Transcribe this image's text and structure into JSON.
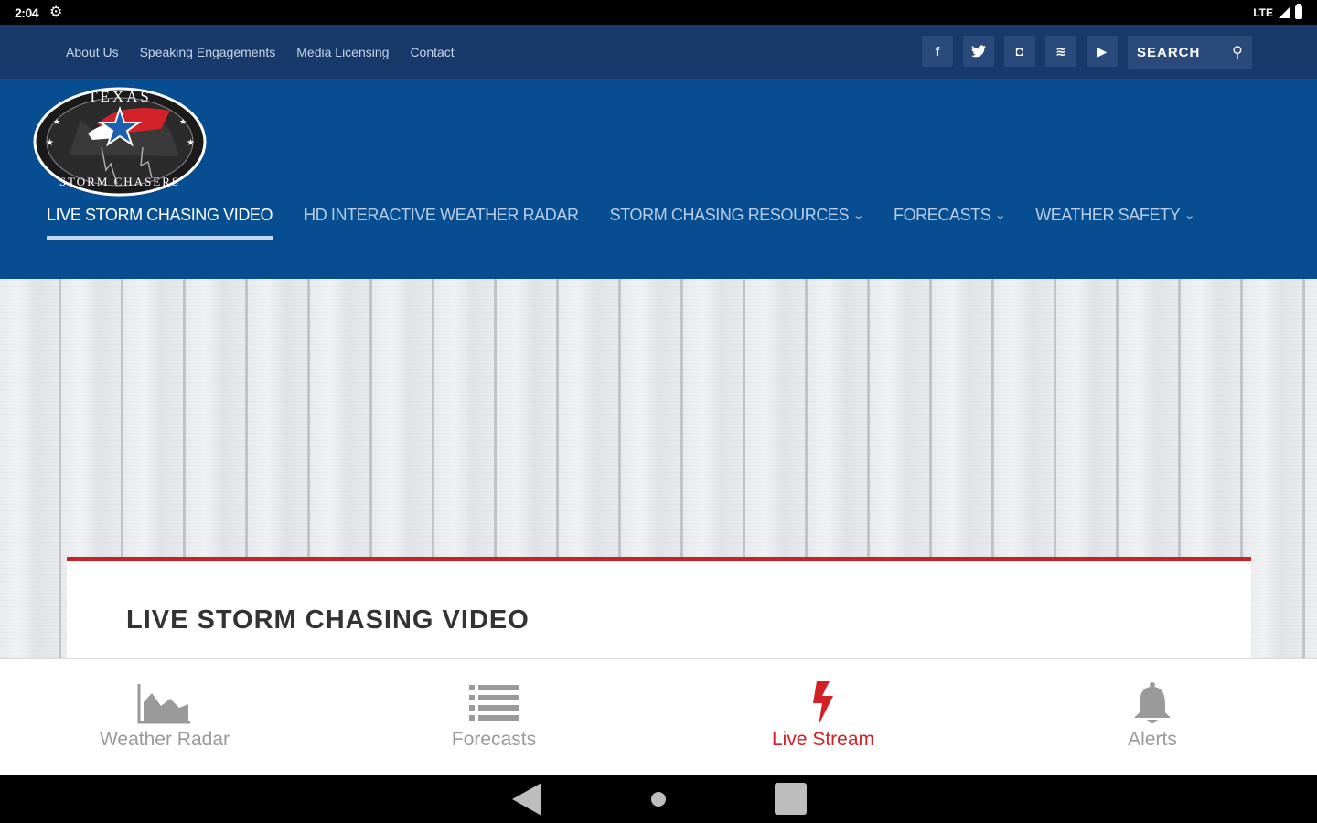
{
  "status_bar": {
    "time": "2:04",
    "network": "LTE"
  },
  "top_links": [
    "About Us",
    "Speaking Engagements",
    "Media Licensing",
    "Contact"
  ],
  "social": {
    "facebook": "f",
    "twitter": "t",
    "instagram": "◘",
    "rss": "≋",
    "youtube": "▶"
  },
  "search": {
    "placeholder": "SEARCH"
  },
  "logo": {
    "top_text": "TEXAS",
    "bottom_text": "STORM CHASERS"
  },
  "nav": {
    "items": [
      {
        "label": "LIVE STORM CHASING VIDEO",
        "active": true
      },
      {
        "label": "HD INTERACTIVE WEATHER RADAR"
      },
      {
        "label": "STORM CHASING RESOURCES",
        "dropdown": true
      },
      {
        "label": "FORECASTS",
        "dropdown": true
      },
      {
        "label": "WEATHER SAFETY",
        "dropdown": true
      }
    ]
  },
  "content": {
    "title": "LIVE STORM CHASING VIDEO"
  },
  "tabs": [
    {
      "label": "Weather Radar",
      "icon": "area-chart-icon"
    },
    {
      "label": "Forecasts",
      "icon": "list-icon"
    },
    {
      "label": "Live Stream",
      "icon": "lightning-icon",
      "active": true
    },
    {
      "label": "Alerts",
      "icon": "bell-icon"
    }
  ],
  "colors": {
    "topbar": "#173a6b",
    "header": "#074d92",
    "accent_red": "#d32027",
    "card_border": "#c8202a"
  }
}
